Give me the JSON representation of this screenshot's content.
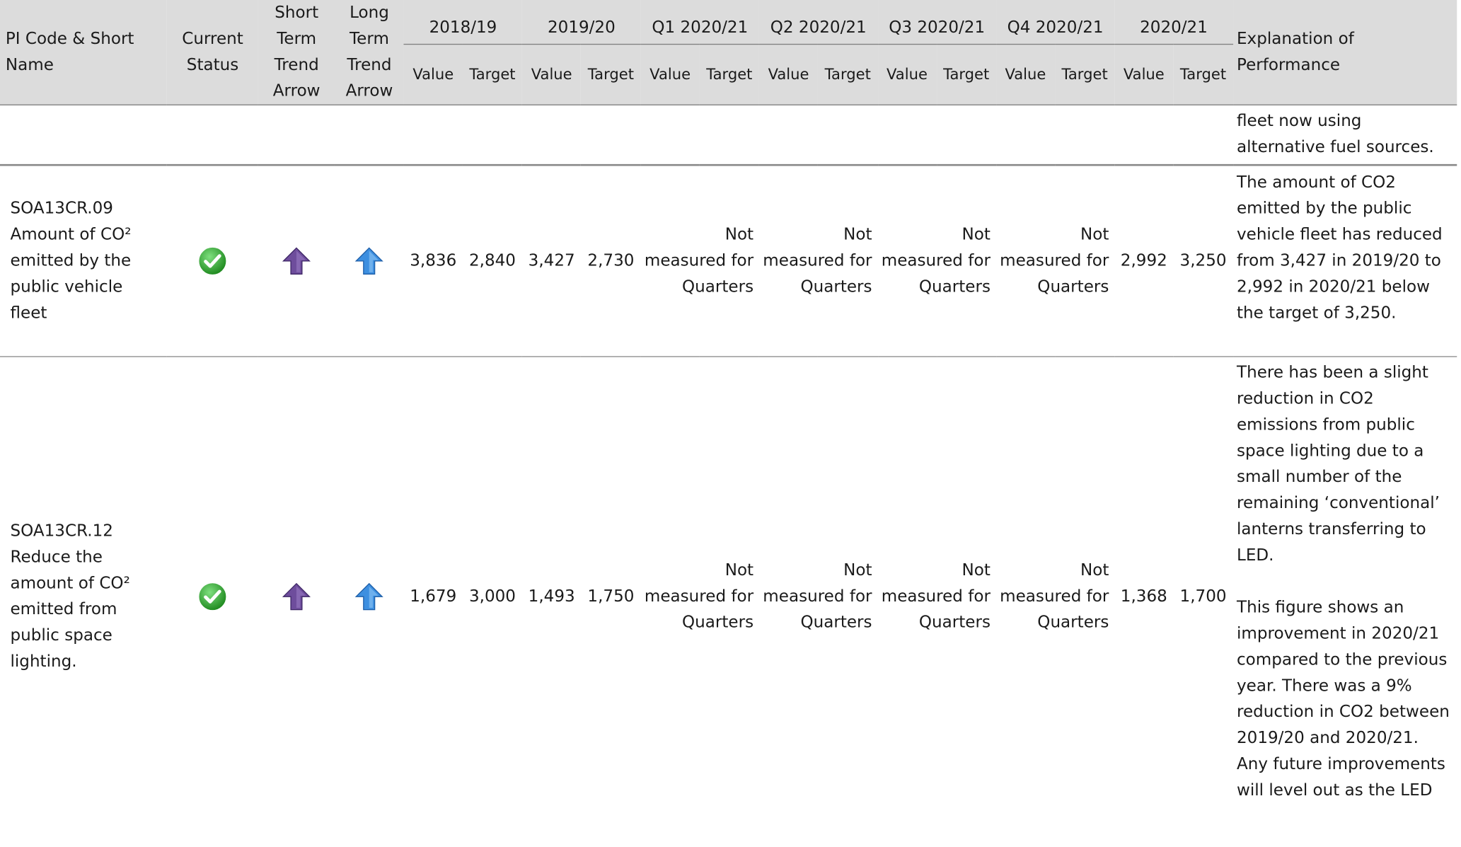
{
  "header": {
    "pi_code": "PI Code & Short Name",
    "current_status": "Current Status",
    "short_trend": "Short Term Trend Arrow",
    "long_trend": "Long Term Trend Arrow",
    "periods": [
      "2018/19",
      "2019/20",
      "Q1 2020/21",
      "Q2 2020/21",
      "Q3 2020/21",
      "Q4 2020/21",
      "2020/21"
    ],
    "value_label": "Value",
    "target_label": "Target",
    "explanation": "Explanation of Performance"
  },
  "continuation": {
    "explanation": "fleet now using alternative fuel sources."
  },
  "rows": [
    {
      "code": "SOA13CR.09",
      "name": "Amount of CO² emitted by the public vehicle fleet",
      "status_icon": "green-check-icon",
      "short_trend_icon": "purple-up-arrow-icon",
      "long_trend_icon": "blue-up-arrow-icon",
      "v2018": "3,836",
      "t2018": "2,840",
      "v2019": "3,427",
      "t2019": "2,730",
      "quarter_note_1": "Not",
      "quarter_note_2": "measured for",
      "quarter_note_3": "Quarters",
      "v2020": "2,992",
      "t2020": "3,250",
      "explanation": "The amount of CO2 emitted by the public vehicle fleet has reduced from 3,427 in 2019/20 to 2,992 in 2020/21 below the target of 3,250."
    },
    {
      "code": "SOA13CR.12",
      "name": "Reduce the amount of CO² emitted from public space lighting.",
      "status_icon": "green-check-icon",
      "short_trend_icon": "purple-up-arrow-icon",
      "long_trend_icon": "blue-up-arrow-icon",
      "v2018": "1,679",
      "t2018": "3,000",
      "v2019": "1,493",
      "t2019": "1,750",
      "quarter_note_1": "Not",
      "quarter_note_2": "measured for",
      "quarter_note_3": "Quarters",
      "v2020": "1,368",
      "t2020": "1,700",
      "explanation_p1": "There has been a slight reduction in CO2 emissions from public space lighting due to a small number of the remaining ‘conventional’ lanterns transferring to LED.",
      "explanation_p2": "This figure shows an improvement in 2020/21 compared to the previous year. There was a 9% reduction in CO2 between 2019/20 and 2020/21. Any future improvements will level out as the LED"
    }
  ],
  "colors": {
    "header_bg": "#dcdcdc",
    "rule": "#8a8a8a",
    "check_green": "#3aa83a",
    "arrow_purple": "#6e4d9c",
    "arrow_blue": "#3d8fe0"
  }
}
